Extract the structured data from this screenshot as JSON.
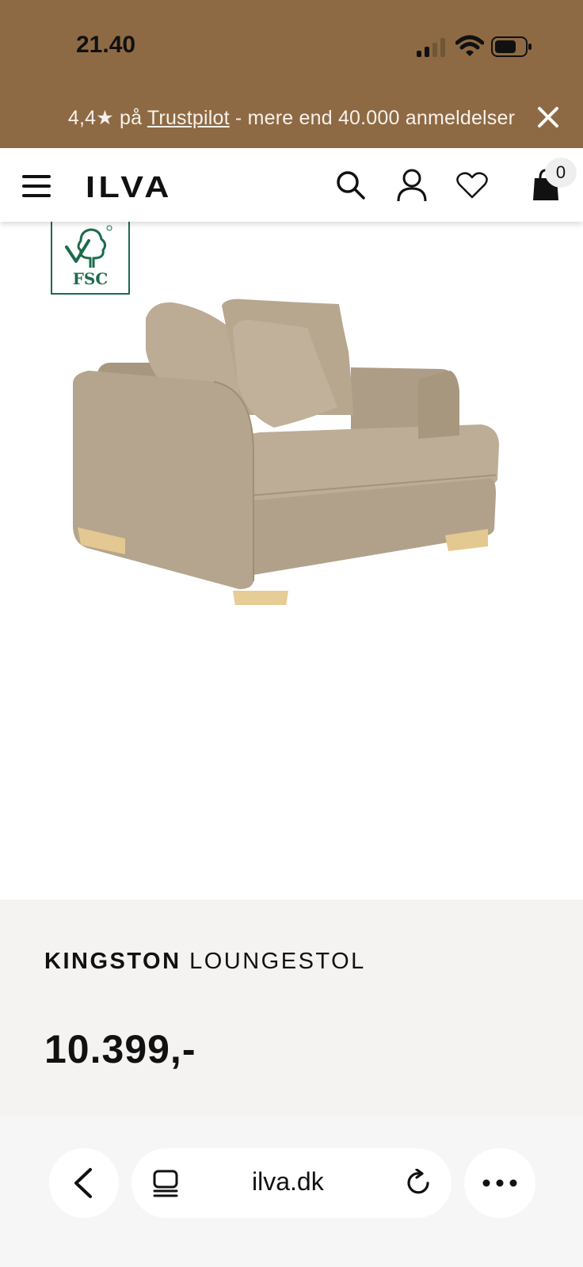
{
  "status_bar": {
    "time": "21.40",
    "background": "#8e6a44"
  },
  "promo": {
    "rating": "4,4★ på ",
    "link": "Trustpilot",
    "rest": " - mere end 40.000 anmeldelser",
    "close_icon": "close-icon"
  },
  "header": {
    "logo": "ILVA",
    "cart_count": "0",
    "icons": [
      "menu-icon",
      "search-icon",
      "account-icon",
      "heart-icon",
      "bag-icon"
    ]
  },
  "product": {
    "badge": "FSC",
    "brand": "KINGSTON",
    "type": " LOUNGESTOL",
    "price": "10.399,-",
    "thumbnails": [
      "front-angle",
      "front",
      "detail"
    ],
    "colors": {
      "fabric": "#b3a38f",
      "wood": "#e3c891",
      "fsc_green": "#1d6b4b"
    }
  },
  "browser": {
    "url": "ilva.dk"
  }
}
